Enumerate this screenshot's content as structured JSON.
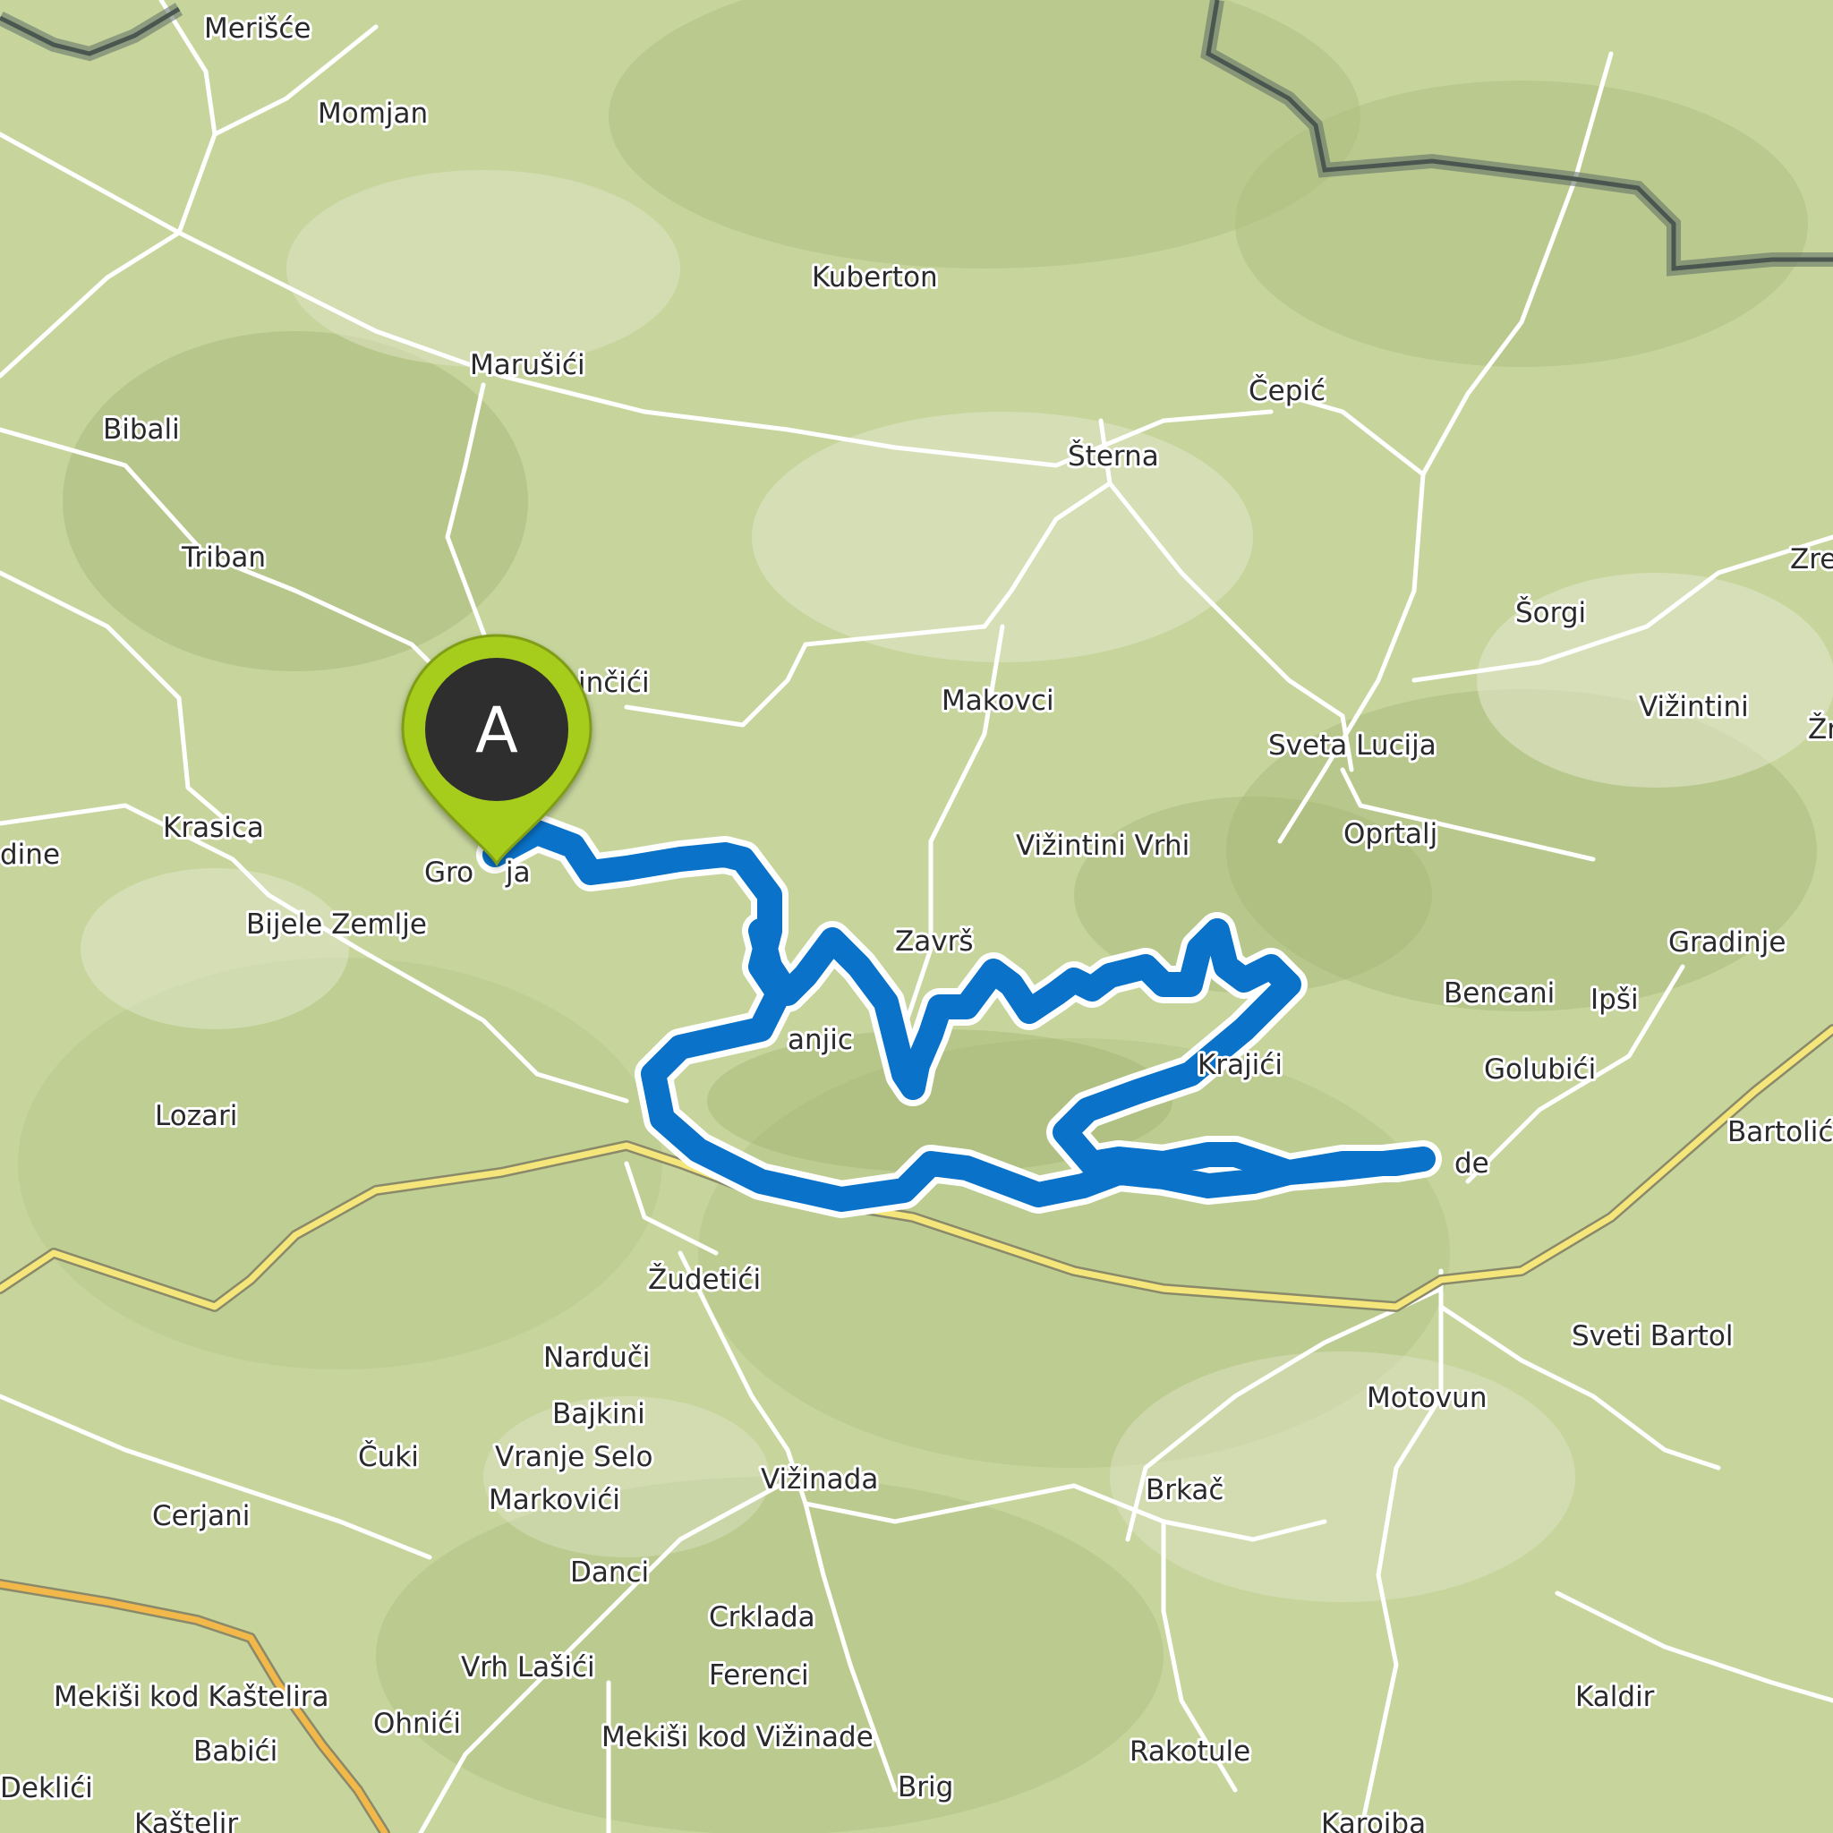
{
  "map": {
    "route_color": "#0a72c8",
    "marker": {
      "letter": "A",
      "color": "#a6cc1c"
    },
    "places": [
      {
        "name": "Merišće",
        "id": "merisce"
      },
      {
        "name": "Momjan",
        "id": "momjan"
      },
      {
        "name": "Kuberton",
        "id": "kuberton"
      },
      {
        "name": "Marušići",
        "id": "marusici"
      },
      {
        "name": "Čepić",
        "id": "cepic"
      },
      {
        "name": "Bibali",
        "id": "bibali"
      },
      {
        "name": "Šterna",
        "id": "sterna"
      },
      {
        "name": "Triban",
        "id": "triban"
      },
      {
        "name": "Zre",
        "id": "zre"
      },
      {
        "name": "Šorgi",
        "id": "sorgi"
      },
      {
        "name": "inčići",
        "id": "incici"
      },
      {
        "name": "Makovci",
        "id": "makovci"
      },
      {
        "name": "Vižintini",
        "id": "vizintini"
      },
      {
        "name": "Žn",
        "id": "zn"
      },
      {
        "name": "Sveta Lucija",
        "id": "sveta-lucija"
      },
      {
        "name": "Krasica",
        "id": "krasica"
      },
      {
        "name": "dine",
        "id": "dine"
      },
      {
        "name": "Vižintini Vrhi",
        "id": "vizintini-vrhi"
      },
      {
        "name": "Oprtalj",
        "id": "oprtalj"
      },
      {
        "name": "Gro",
        "id": "grozn"
      },
      {
        "name": "ja",
        "id": "ja"
      },
      {
        "name": "Bijele Zemlje",
        "id": "bijele-zemlje"
      },
      {
        "name": "Završ",
        "id": "zavrs"
      },
      {
        "name": "Gradinje",
        "id": "gradinje"
      },
      {
        "name": "Bencani",
        "id": "bencani"
      },
      {
        "name": "Ipši",
        "id": "ipsi"
      },
      {
        "name": "anjic",
        "id": "anjici"
      },
      {
        "name": "Krajići",
        "id": "krajici"
      },
      {
        "name": "Golubići",
        "id": "golubici"
      },
      {
        "name": "Lozari",
        "id": "lozari"
      },
      {
        "name": "Bartolić",
        "id": "bartolici"
      },
      {
        "name": "de",
        "id": "de"
      },
      {
        "name": "Žudetići",
        "id": "zudetici"
      },
      {
        "name": "Narduči",
        "id": "narduci"
      },
      {
        "name": "Sveti Bartol",
        "id": "sveti-bartol"
      },
      {
        "name": "Motovun",
        "id": "motovun"
      },
      {
        "name": "Bajkini",
        "id": "bajkini"
      },
      {
        "name": "Čuki",
        "id": "cuki"
      },
      {
        "name": "Vranje Selo",
        "id": "vranje-selo"
      },
      {
        "name": "Vižinada",
        "id": "vizinada"
      },
      {
        "name": "Cerjani",
        "id": "cerjani"
      },
      {
        "name": "Markovići",
        "id": "markovici"
      },
      {
        "name": "Brkač",
        "id": "brkac"
      },
      {
        "name": "Danci",
        "id": "danci"
      },
      {
        "name": "Crklada",
        "id": "crklada"
      },
      {
        "name": "Vrh Lašići",
        "id": "vrh-lasici"
      },
      {
        "name": "Ferenci",
        "id": "ferenci"
      },
      {
        "name": "Mekiši kod Kaštelira",
        "id": "mekisi-kod-kastelira"
      },
      {
        "name": "Kaldir",
        "id": "kaldir"
      },
      {
        "name": "Ohnići",
        "id": "ohnici"
      },
      {
        "name": "Babići",
        "id": "babici"
      },
      {
        "name": "Mekiši kod Vižinade",
        "id": "mekisi-kod-vizinade"
      },
      {
        "name": "Rakotule",
        "id": "rakotule"
      },
      {
        "name": "Deklići",
        "id": "deklici"
      },
      {
        "name": "Brig",
        "id": "brig"
      },
      {
        "name": "Kaštelir",
        "id": "kastelir"
      },
      {
        "name": "Karojba",
        "id": "karojba"
      }
    ]
  }
}
